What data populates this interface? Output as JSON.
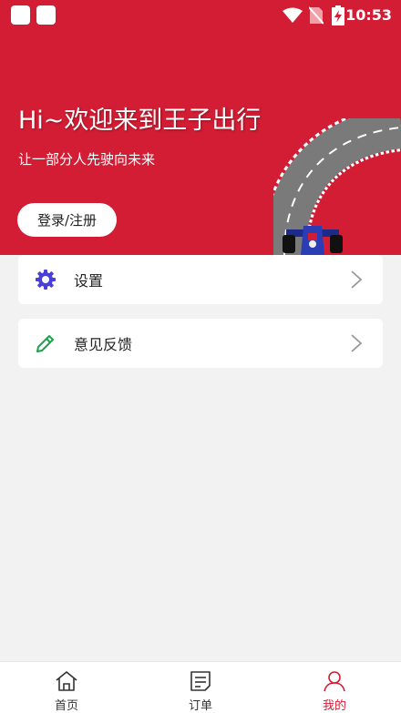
{
  "status_bar": {
    "time": "10:53"
  },
  "hero": {
    "title": "Hi~欢迎来到王子出行",
    "subtitle": "让一部分人先驶向未来",
    "login_label": "登录/注册",
    "bg_color": "#d31d34"
  },
  "menu": {
    "items": [
      {
        "label": "设置",
        "icon": "gear-icon",
        "color": "#4a3fd6"
      },
      {
        "label": "意见反馈",
        "icon": "pencil-icon",
        "color": "#1aa34a"
      }
    ]
  },
  "tabbar": {
    "tabs": [
      {
        "label": "首页",
        "icon": "home-icon"
      },
      {
        "label": "订单",
        "icon": "order-list-icon"
      },
      {
        "label": "我的",
        "icon": "person-icon",
        "active": true
      }
    ],
    "active_color": "#d31d34"
  }
}
